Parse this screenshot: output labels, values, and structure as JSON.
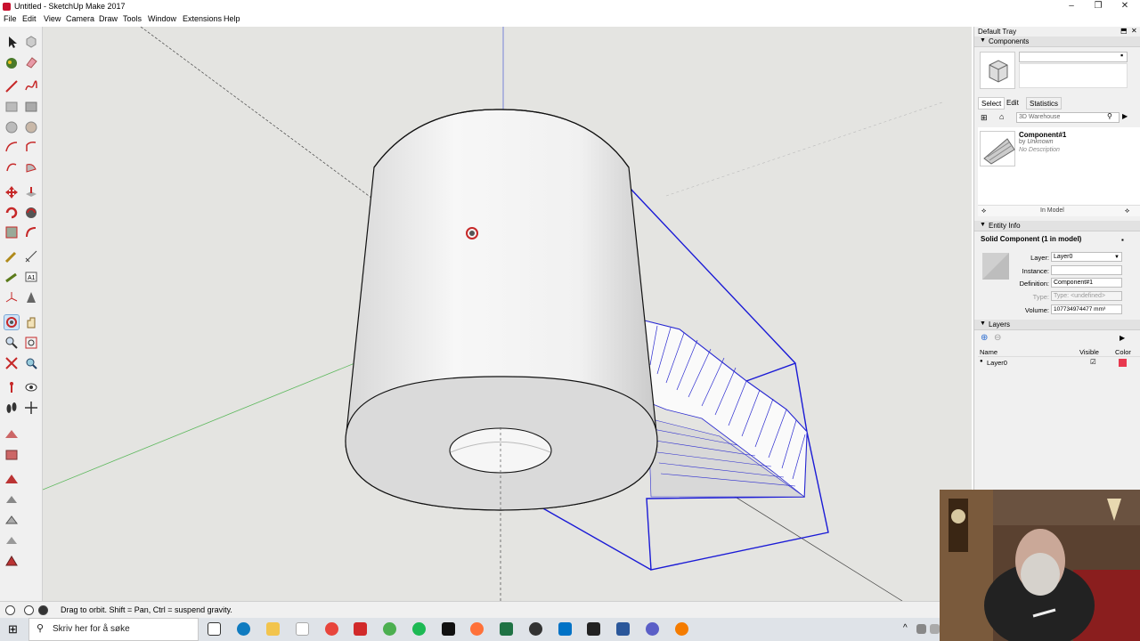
{
  "window": {
    "title": "Untitled - SketchUp Make 2017",
    "controls": [
      "–",
      "❐",
      "✕"
    ]
  },
  "menu": [
    "File",
    "Edit",
    "View",
    "Camera",
    "Draw",
    "Tools",
    "Window",
    "Extensions",
    "Help"
  ],
  "status": {
    "text": "Drag to orbit. Shift = Pan, Ctrl = suspend gravity."
  },
  "tray": {
    "title": "Default Tray",
    "components": {
      "title": "Components",
      "tabs": [
        "Select",
        "Edit",
        "Statistics"
      ],
      "search_placeholder": "3D Warehouse",
      "item_name": "Component#1",
      "item_by": "by",
      "item_author": "Unknown",
      "item_description": "No Description",
      "footer": "In Model"
    },
    "entity_info": {
      "title": "Entity Info",
      "subtitle": "Solid Component (1 in model)",
      "layer_label": "Layer:",
      "layer_value": "Layer0",
      "instance_label": "Instance:",
      "instance_value": "",
      "definition_label": "Definition:",
      "definition_value": "Component#1",
      "type_label": "Type:",
      "type_value": "Type: <undefined>",
      "volume_label": "Volume:",
      "volume_value": "107734974477 mm³"
    },
    "layers": {
      "title": "Layers",
      "col_name": "Name",
      "col_visible": "Visible",
      "col_color": "Color",
      "rows": [
        {
          "name": "Layer0",
          "visible": "☑",
          "color": "#e8384f"
        }
      ]
    }
  },
  "taskbar": {
    "search_placeholder": "Skriv her for å søke"
  },
  "colors": {
    "viewport_bg": "#e4e4e1",
    "selection_blue": "#1a1ad6",
    "axis_green": "#5cb85c",
    "axis_blue": "#5b6bd6"
  }
}
